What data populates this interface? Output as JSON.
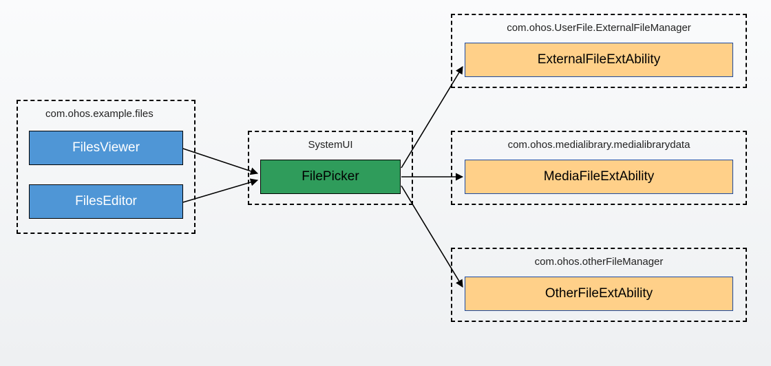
{
  "left_group": {
    "title": "com.ohos.example.files",
    "nodes": {
      "viewer": "FilesViewer",
      "editor": "FilesEditor"
    }
  },
  "center_group": {
    "title": "SystemUI",
    "node": "FilePicker"
  },
  "right_groups": [
    {
      "title": "com.ohos.UserFile.ExternalFileManager",
      "node": "ExternalFileExtAbility"
    },
    {
      "title": "com.ohos.medialibrary.medialibrarydata",
      "node": "MediaFileExtAbility"
    },
    {
      "title": "com.ohos.otherFileManager",
      "node": "OtherFileExtAbility"
    }
  ]
}
